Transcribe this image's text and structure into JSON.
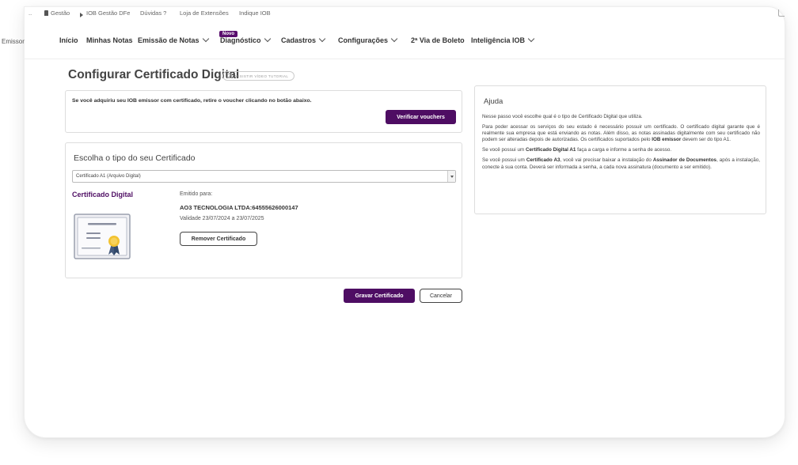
{
  "topbar": {
    "items": [
      "Gestão",
      "IOB Gestão DFe",
      "Dúvidas ?",
      "Loja de Extensões",
      "Indique IOB"
    ]
  },
  "nav": {
    "emissor_label": "Emissor",
    "items": [
      "Início",
      "Minhas Notas",
      "Emissão de Notas",
      "Diagnóstico",
      "Cadastros",
      "Configurações",
      "2ª Via de Boleto",
      "Inteligência IOB"
    ],
    "novo_badge": "Novo"
  },
  "page": {
    "title": "Configurar Certificado Digital",
    "tutorial_label": "ASSISTIR VÍDEO TUTORIAL"
  },
  "voucher": {
    "text": "Se você adquiriu seu IOB emissor com certificado, retire o voucher clicando no botão abaixo.",
    "button": "Verificar vouchers"
  },
  "certificate": {
    "heading": "Escolha o tipo do seu Certificado",
    "select_value": "Certificado A1 (Arquivo Digital)",
    "label": "Certificado Digital",
    "emitted_label": "Emitido para:",
    "company": "AO3 TECNOLOGIA LTDA:64555626000147",
    "validity": "Validade 23/07/2024 a 23/07/2025",
    "remove_button": "Remover Certificado"
  },
  "actions": {
    "save": "Gravar Certificado",
    "cancel": "Cancelar"
  },
  "help": {
    "title": "Ajuda",
    "p1": "Nesse passo você escolhe qual é o tipo de Certificado Digital que utiliza.",
    "p2_a": "Para poder acessar os serviços do seu estado é necessário possuir um certificado. O certificado digital garante que é realmente sua empresa que está enviando as notas. Além disso, as notas assinadas digitalmente com seu certificado não podem ser alteradas depois de autorizadas. Os certificados suportados pelo ",
    "p2_b": "IOB emissor",
    "p2_c": " devem ser do tipo A1.",
    "p3_a": "Se você possui um ",
    "p3_b": "Certificado Digital A1",
    "p3_c": " faça a carga e informe a senha de acesso.",
    "p4_a": "Se você possui um ",
    "p4_b": "Certificado A3",
    "p4_c": ", você vai precisar baixar a instalação do ",
    "p4_d": "Assinador de Documentos",
    "p4_e": ", após a instalação, conecte à sua conta. Deverá ser informada a senha, a cada nova assinatura (documento a ser emitido)."
  },
  "colors": {
    "brand": "#4e0d63"
  }
}
